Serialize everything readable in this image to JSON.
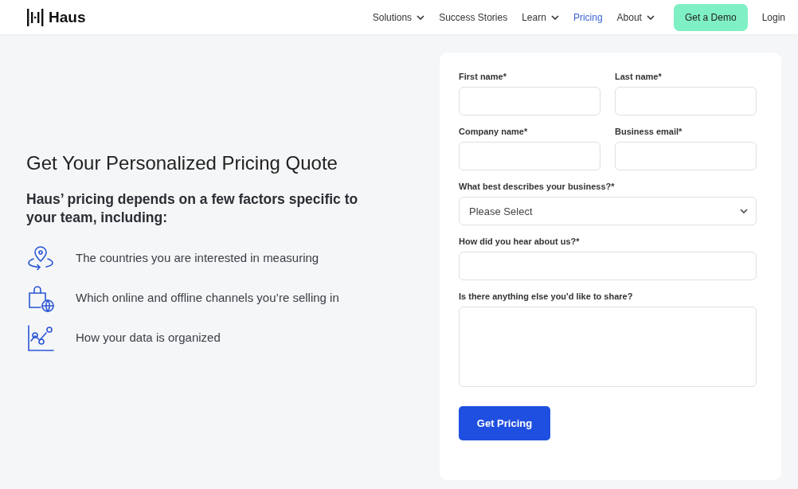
{
  "header": {
    "logo": "Haus",
    "nav": [
      {
        "label": "Solutions",
        "dropdown": true,
        "selected": false
      },
      {
        "label": "Success Stories",
        "dropdown": false,
        "selected": false
      },
      {
        "label": "Learn",
        "dropdown": true,
        "selected": false
      },
      {
        "label": "Pricing",
        "dropdown": false,
        "selected": true
      },
      {
        "label": "About",
        "dropdown": true,
        "selected": false
      }
    ],
    "cta": "Get a Demo",
    "login": "Login"
  },
  "intro": {
    "title": "Get Your Personalized Pricing Quote",
    "subtitle": "Haus’ pricing depends on a few factors specific to your team, including:",
    "factors": [
      {
        "kind": "location",
        "text": "The countries you are interested in measuring"
      },
      {
        "kind": "bag",
        "text": "Which online and offline channels you’re selling in"
      },
      {
        "kind": "chart",
        "text": "How your data is organized"
      }
    ]
  },
  "form": {
    "rows": [
      [
        {
          "label": "First name*",
          "kind": "text"
        },
        {
          "label": "Last name*",
          "kind": "text"
        }
      ],
      [
        {
          "label": "Company name*",
          "kind": "text"
        },
        {
          "label": "Business email*",
          "kind": "text"
        }
      ],
      [
        {
          "label": "What best describes your business?*",
          "kind": "select",
          "value": "Please Select"
        }
      ],
      [
        {
          "label": "How did you hear about us?*",
          "kind": "text"
        }
      ],
      [
        {
          "label": "Is there anything else you'd like to share?",
          "kind": "textarea"
        }
      ]
    ],
    "submit": "Get Pricing"
  }
}
